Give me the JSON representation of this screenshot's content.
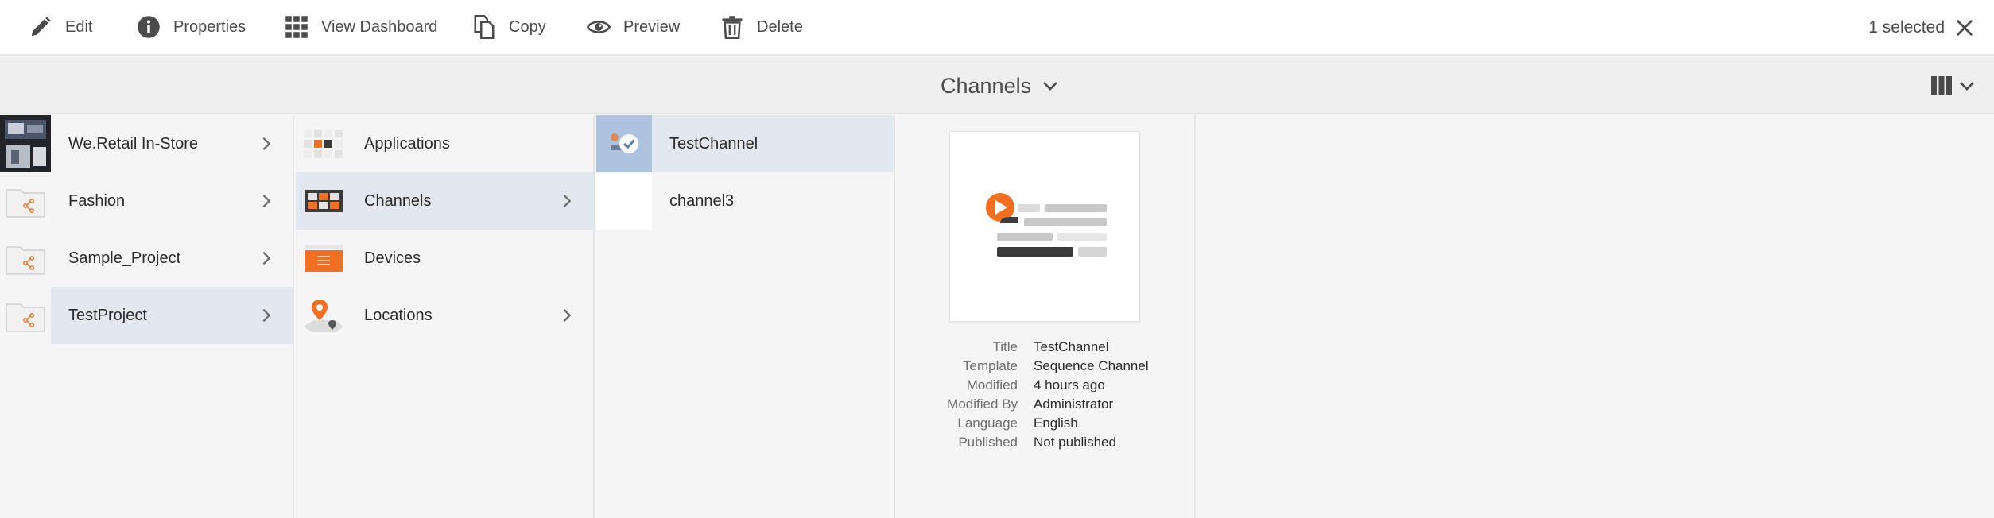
{
  "actionbar": {
    "actions": [
      {
        "label": "Edit",
        "icon": "pencil-icon"
      },
      {
        "label": "Properties",
        "icon": "info-icon"
      },
      {
        "label": "View Dashboard",
        "icon": "dashboard-grid-icon"
      },
      {
        "label": "Copy",
        "icon": "copy-icon"
      },
      {
        "label": "Preview",
        "icon": "eye-icon"
      },
      {
        "label": "Delete",
        "icon": "trash-icon"
      }
    ],
    "selection_text": "1 selected"
  },
  "titlebar": {
    "title": "Channels"
  },
  "columns": {
    "projects": [
      {
        "label": "We.Retail In-Store",
        "active": false
      },
      {
        "label": "Fashion",
        "active": false
      },
      {
        "label": "Sample_Project",
        "active": false
      },
      {
        "label": "TestProject",
        "active": true
      }
    ],
    "categories": [
      {
        "label": "Applications",
        "active": false
      },
      {
        "label": "Channels",
        "active": true
      },
      {
        "label": "Devices",
        "active": false
      },
      {
        "label": "Locations",
        "active": false
      }
    ],
    "channels": [
      {
        "label": "TestChannel",
        "active": true
      },
      {
        "label": "channel3",
        "active": false
      }
    ]
  },
  "preview": {
    "meta": [
      {
        "key": "Title",
        "value": "TestChannel"
      },
      {
        "key": "Template",
        "value": "Sequence Channel"
      },
      {
        "key": "Modified",
        "value": "4 hours ago"
      },
      {
        "key": "Modified By",
        "value": "Administrator"
      },
      {
        "key": "Language",
        "value": "English"
      },
      {
        "key": "Published",
        "value": "Not published"
      }
    ]
  },
  "colors": {
    "accent_orange": "#f26f21",
    "selected_row": "#e3e8f0",
    "selected_thumb": "#aec3df"
  }
}
